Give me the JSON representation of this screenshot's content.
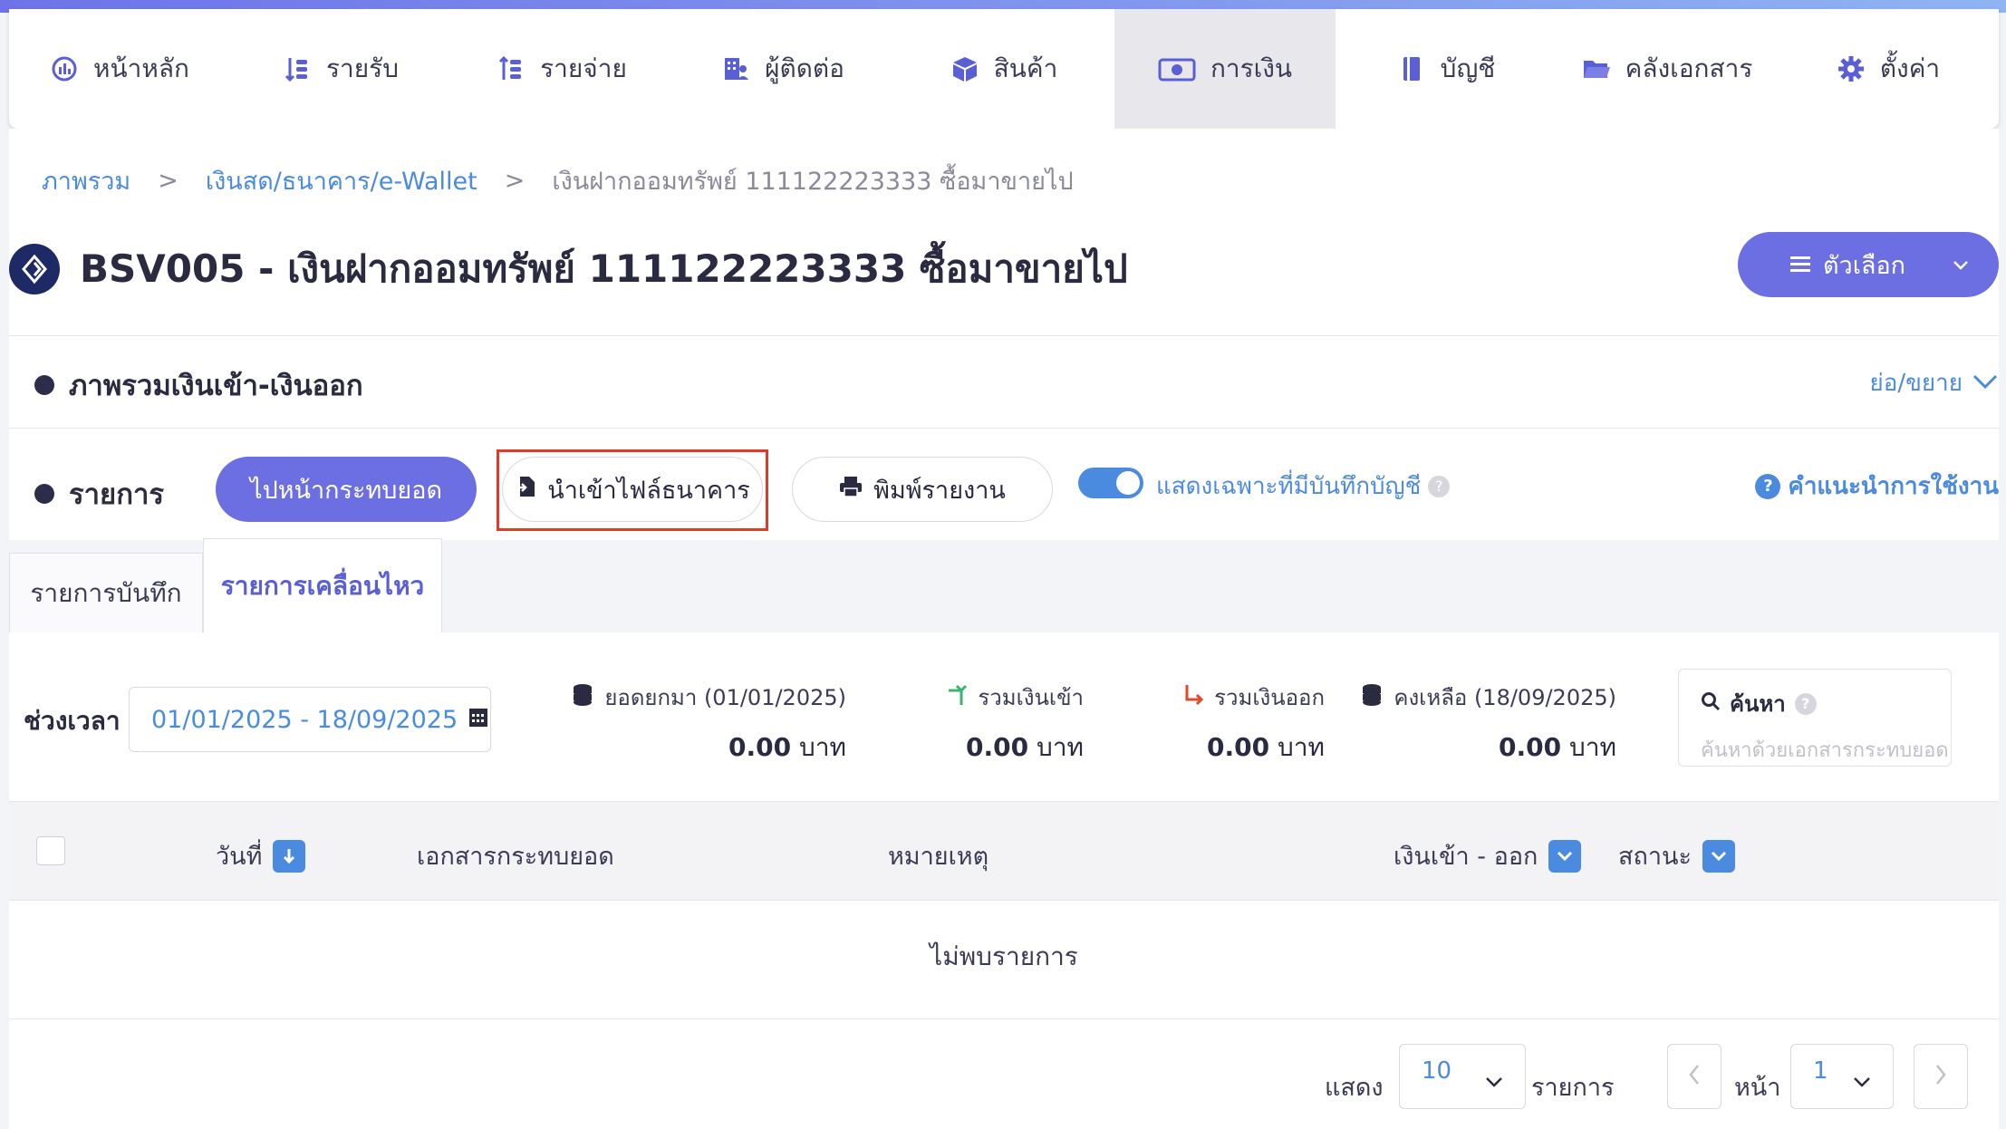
{
  "nav": {
    "items": [
      {
        "label": "หน้าหลัก",
        "icon": "dashboard-icon"
      },
      {
        "label": "รายรับ",
        "icon": "income-icon"
      },
      {
        "label": "รายจ่าย",
        "icon": "expense-icon"
      },
      {
        "label": "ผู้ติดต่อ",
        "icon": "contacts-icon"
      },
      {
        "label": "สินค้า",
        "icon": "product-box-icon"
      },
      {
        "label": "การเงิน",
        "icon": "money-icon",
        "active": true
      },
      {
        "label": "บัญชี",
        "icon": "ledger-icon"
      },
      {
        "label": "คลังเอกสาร",
        "icon": "folder-icon"
      },
      {
        "label": "ตั้งค่า",
        "icon": "gear-icon"
      }
    ]
  },
  "breadcrumb": {
    "home": "ภาพรวม",
    "section": "เงินสด/ธนาคาร/e-Wallet",
    "current": "เงินฝากออมทรัพย์ 111122223333 ซื้อมาขายไป",
    "separator": ">"
  },
  "page": {
    "title": "BSV005 - เงินฝากออมทรัพย์ 111122223333 ซื้อมาขายไป",
    "options_label": "ตัวเลือก"
  },
  "overview": {
    "title": "ภาพรวมเงินเข้า-เงินออก",
    "toggle_label": "ย่อ/ขยาย"
  },
  "toolbar": {
    "section_label": "รายการ",
    "reconcile_label": "ไปหน้ากระทบยอด",
    "import_label": "นำเข้าไฟล์ธนาคาร",
    "print_label": "พิมพ์รายงาน",
    "filter_toggle_label": "แสดงเฉพาะที่มีบันทึกบัญชี",
    "filter_toggle_on": true,
    "help_label": "คำแนะนำการใช้งาน"
  },
  "tabs": [
    {
      "label": "รายการบันทึก",
      "active": false
    },
    {
      "label": "รายการเคลื่อนไหว",
      "active": true
    }
  ],
  "filters": {
    "period_label": "ช่วงเวลา",
    "date_range": "01/01/2025 - 18/09/2025"
  },
  "stats": {
    "opening": {
      "label": "ยอดยกมา (01/01/2025)",
      "value": "0.00",
      "unit": "บาท"
    },
    "income": {
      "label": "รวมเงินเข้า",
      "value": "0.00",
      "unit": "บาท"
    },
    "expense": {
      "label": "รวมเงินออก",
      "value": "0.00",
      "unit": "บาท"
    },
    "balance": {
      "label": "คงเหลือ (18/09/2025)",
      "value": "0.00",
      "unit": "บาท"
    }
  },
  "search": {
    "title": "ค้นหา",
    "placeholder": "ค้นหาด้วยเอกสารกระทบยอด"
  },
  "table": {
    "columns": [
      "วันที่",
      "เอกสารกระทบยอด",
      "หมายเหตุ",
      "เงินเข้า - ออก",
      "สถานะ"
    ],
    "empty_text": "ไม่พบรายการ"
  },
  "pagination": {
    "show_label": "แสดง",
    "page_size": "10",
    "items_label": "รายการ",
    "page_label": "หน้า",
    "page": "1"
  },
  "colors": {
    "accent": "#6c6fe2",
    "link": "#4a8be0",
    "highlight": "#e23a2a"
  }
}
